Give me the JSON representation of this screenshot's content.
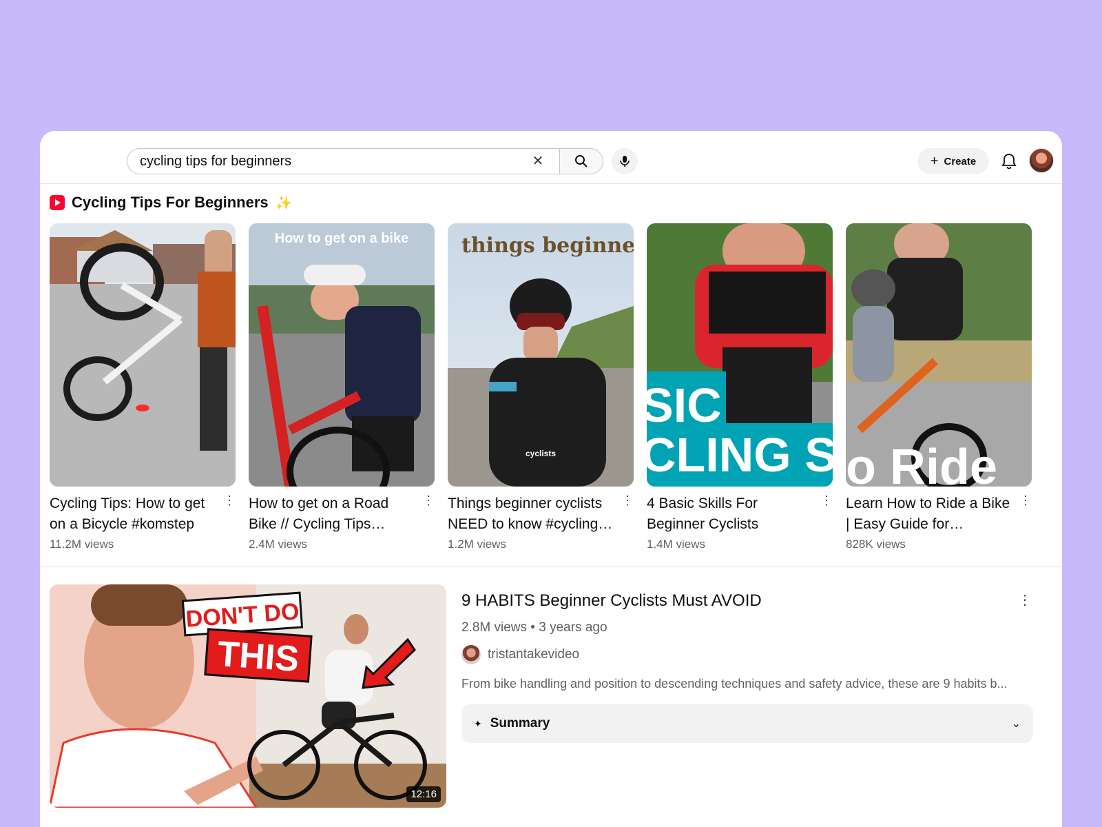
{
  "search": {
    "value": "cycling tips for beginners",
    "clear_icon": "close-icon",
    "search_icon": "search-icon",
    "mic_icon": "mic-icon"
  },
  "header": {
    "create_label": "Create",
    "notifications_icon": "bell-icon"
  },
  "shorts": {
    "title": "Cycling Tips For Beginners",
    "sparkle": "✨",
    "items": [
      {
        "title": "Cycling Tips: How to get on a Bicycle #komstep",
        "views": "11.2M views",
        "overlay": ""
      },
      {
        "title": "How to get on a Road Bike // Cycling Tips…",
        "views": "2.4M views",
        "overlay": "How to get on a bike"
      },
      {
        "title": "Things beginner cyclists NEED to know #cycling…",
        "views": "1.2M views",
        "overlay": "things beginners",
        "overlay2": "cyclists"
      },
      {
        "title": "4 Basic Skills For Beginner Cyclists",
        "views": "1.4M views",
        "overlay": "SIC",
        "overlay2": "CLING S"
      },
      {
        "title": "Learn How to Ride a Bike | Easy Guide for…",
        "views": "828K views",
        "overlay": "o Ride"
      }
    ]
  },
  "video": {
    "title": "9 HABITS Beginner Cyclists Must AVOID",
    "meta": "2.8M views • 3 years ago",
    "channel": "tristantakevideo",
    "description": "From bike handling and position to descending techniques and safety advice, these are 9 habits b...",
    "duration": "12:16",
    "thumb_text1": "DON'T DO",
    "thumb_text2": "THIS",
    "summary_label": "Summary"
  },
  "colors": {
    "background": "#c8b9fb",
    "accent": "#ff0033",
    "teal": "#00a3b4"
  }
}
